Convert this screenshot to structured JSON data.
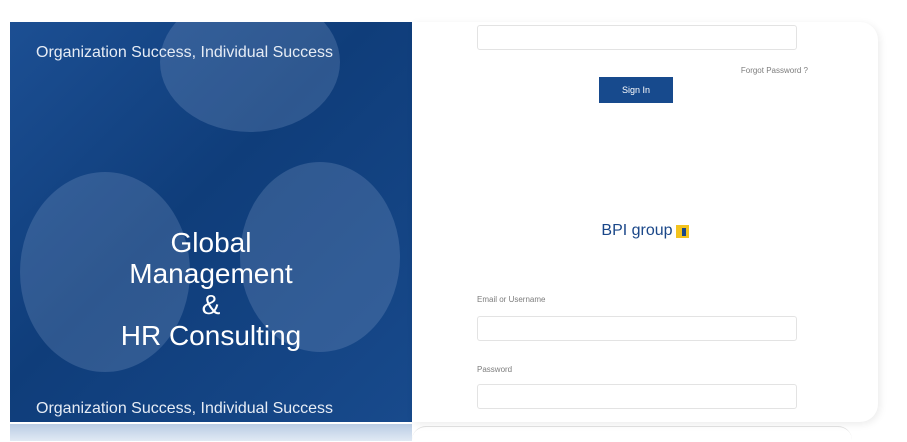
{
  "hero": {
    "tagline_top": "Organization Success, Individual Success",
    "headline": [
      "Global",
      "Management",
      "&",
      "HR Consulting"
    ],
    "tagline_bottom": "Organization Success, Individual Success",
    "background_color": "#174a8d"
  },
  "login_top": {
    "forgot_password": "Forgot Password ?",
    "signin_label": "Sign In"
  },
  "brand": {
    "name": "BPI group",
    "logo_icon": "bpi-logo-icon",
    "color": "#1a4789"
  },
  "form": {
    "email_label": "Email or Username",
    "password_label": "Password"
  }
}
